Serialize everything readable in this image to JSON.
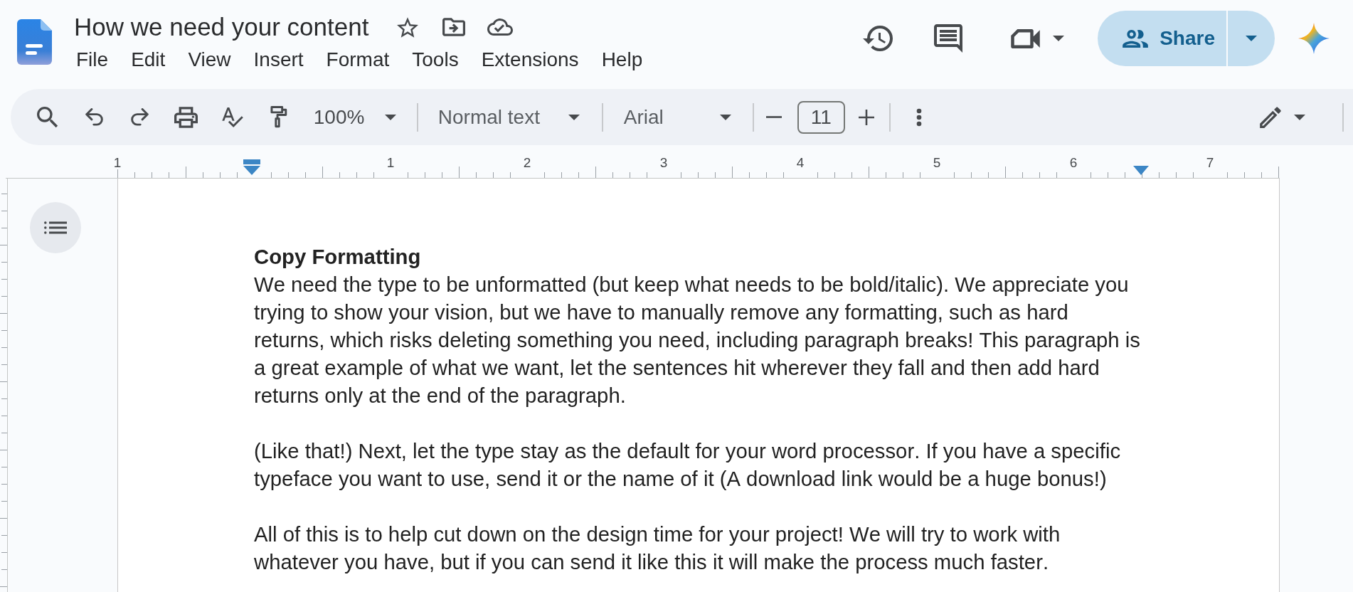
{
  "document_title": "How we need your content",
  "menu": [
    "File",
    "Edit",
    "View",
    "Insert",
    "Format",
    "Tools",
    "Extensions",
    "Help"
  ],
  "share_button": {
    "label": "Share"
  },
  "toolbar": {
    "zoom": "100%",
    "paragraph_style": "Normal text",
    "font": "Arial",
    "font_size": "11"
  },
  "ruler": {
    "labels": [
      "1",
      "1",
      "2",
      "3",
      "4",
      "5",
      "6",
      "7"
    ]
  },
  "document": {
    "heading": "Copy Formatting",
    "paragraphs": [
      "We need the type to be unformatted (but keep what needs to be bold/italic). We appreciate you trying to show your vision, but we have to manually remove any formatting, such as hard returns, which risks deleting something you need, including paragraph breaks! This paragraph is a great example of what we want, let the sentences hit wherever they fall and then add hard returns only at the end of the paragraph.",
      "(Like that!) Next, let the type stay as the default for your word processor. If you have a specific typeface you want to use, send it or the name of it (A download link would be a huge bonus!)",
      "All of this is to help cut down on the design time for your project! We will try to work with whatever you have, but if you can send it like this it will make the process much faster."
    ]
  }
}
